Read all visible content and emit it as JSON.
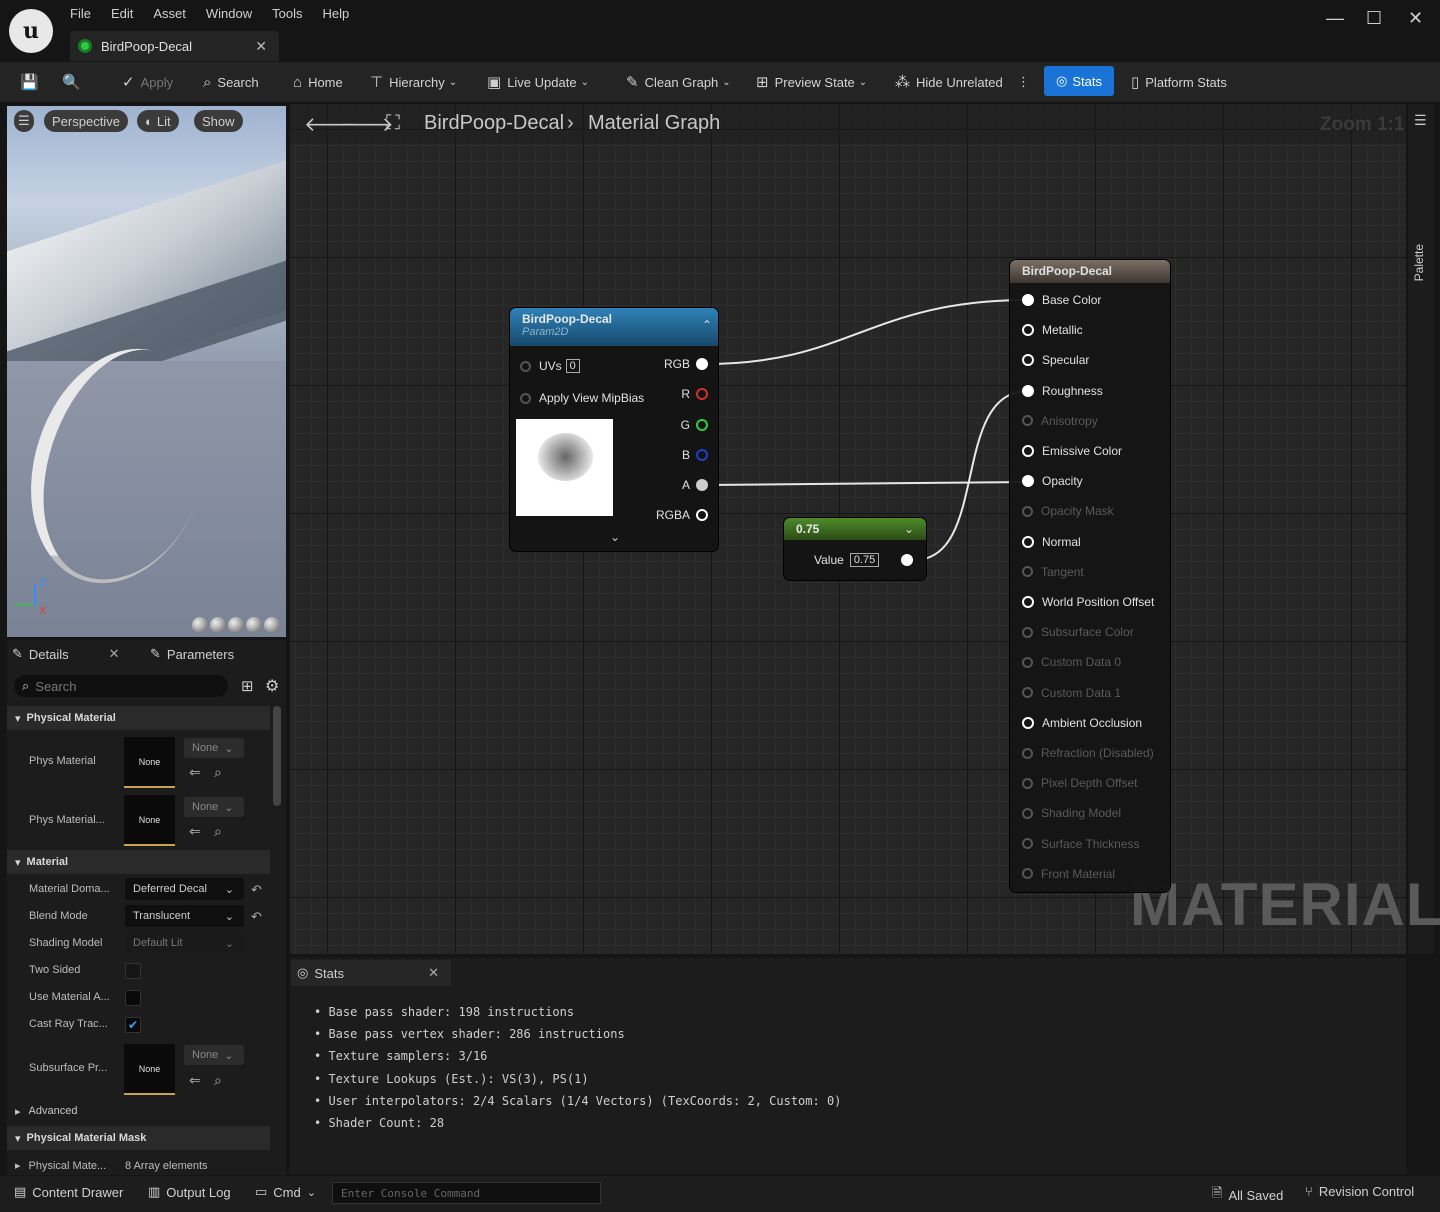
{
  "menu": [
    "File",
    "Edit",
    "Asset",
    "Window",
    "Tools",
    "Help"
  ],
  "document_tab": "BirdPoop-Decal",
  "toolbar": {
    "apply": "Apply",
    "search": "Search",
    "home": "Home",
    "hierarchy": "Hierarchy",
    "live_update": "Live Update",
    "clean_graph": "Clean Graph",
    "preview_state": "Preview State",
    "hide_unrelated": "Hide Unrelated",
    "stats": "Stats",
    "platform_stats": "Platform Stats"
  },
  "viewport": {
    "perspective": "Perspective",
    "lit": "Lit",
    "show": "Show",
    "axis_z": "Z",
    "axis_x": "X"
  },
  "details": {
    "tab_details": "Details",
    "tab_parameters": "Parameters",
    "search_placeholder": "Search",
    "sections": {
      "physical_material": "Physical Material",
      "material": "Material",
      "advanced": "Advanced",
      "physical_material_mask": "Physical Material Mask"
    },
    "phys_material_label": "Phys Material",
    "phys_material2_label": "Phys Material...",
    "none": "None",
    "material_domain_label": "Material Doma...",
    "material_domain_value": "Deferred Decal",
    "blend_mode_label": "Blend Mode",
    "blend_mode_value": "Translucent",
    "shading_model_label": "Shading Model",
    "shading_model_value": "Default Lit",
    "two_sided_label": "Two Sided",
    "use_material_label": "Use Material A...",
    "cast_ray_label": "Cast Ray Trac...",
    "subsurface_label": "Subsurface Pr...",
    "phys_mask_label": "Physical Mate...",
    "phys_mask_value": "8 Array elements"
  },
  "graph": {
    "breadcrumb_asset": "BirdPoop-Decal",
    "breadcrumb_graph": "Material Graph",
    "zoom": "Zoom 1:1",
    "palette": "Palette",
    "watermark": "MATERIAL"
  },
  "texture_node": {
    "title": "BirdPoop-Decal",
    "subtitle": "Param2D",
    "uvs_label": "UVs",
    "uvs_value": "0",
    "mipbias_label": "Apply View MipBias",
    "outputs": [
      "RGB",
      "R",
      "G",
      "B",
      "A",
      "RGBA"
    ]
  },
  "scalar_node": {
    "title": "0.75",
    "value_label": "Value",
    "value": "0.75"
  },
  "material_node": {
    "title": "BirdPoop-Decal",
    "inputs": [
      {
        "label": "Base Color",
        "state": "connected"
      },
      {
        "label": "Metallic",
        "state": "active"
      },
      {
        "label": "Specular",
        "state": "active"
      },
      {
        "label": "Roughness",
        "state": "connected"
      },
      {
        "label": "Anisotropy",
        "state": "disabled"
      },
      {
        "label": "Emissive Color",
        "state": "active"
      },
      {
        "label": "Opacity",
        "state": "connected"
      },
      {
        "label": "Opacity Mask",
        "state": "disabled"
      },
      {
        "label": "Normal",
        "state": "active"
      },
      {
        "label": "Tangent",
        "state": "disabled"
      },
      {
        "label": "World Position Offset",
        "state": "active"
      },
      {
        "label": "Subsurface Color",
        "state": "disabled"
      },
      {
        "label": "Custom Data 0",
        "state": "disabled"
      },
      {
        "label": "Custom Data 1",
        "state": "disabled"
      },
      {
        "label": "Ambient Occlusion",
        "state": "active"
      },
      {
        "label": "Refraction (Disabled)",
        "state": "disabled"
      },
      {
        "label": "Pixel Depth Offset",
        "state": "disabled"
      },
      {
        "label": "Shading Model",
        "state": "disabled"
      },
      {
        "label": "Surface Thickness",
        "state": "disabled"
      },
      {
        "label": "Front Material",
        "state": "disabled"
      }
    ]
  },
  "stats": {
    "tab": "Stats",
    "lines": [
      "Base pass shader: 198 instructions",
      "Base pass vertex shader: 286 instructions",
      "Texture samplers: 3/16",
      "Texture Lookups (Est.): VS(3), PS(1)",
      "User interpolators: 2/4 Scalars (1/4 Vectors) (TexCoords: 2, Custom: 0)",
      "Shader Count: 28"
    ]
  },
  "bottom": {
    "content_drawer": "Content Drawer",
    "output_log": "Output Log",
    "cmd": "Cmd",
    "console_placeholder": "Enter Console Command",
    "all_saved": "All Saved",
    "revision_control": "Revision Control"
  }
}
